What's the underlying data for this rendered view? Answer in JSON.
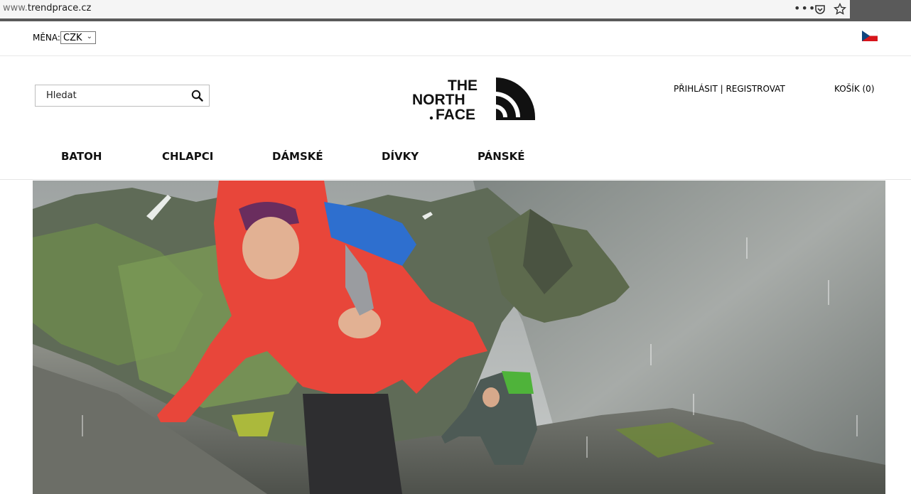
{
  "browser": {
    "url_prefix": "www.",
    "url_domain": "trendprace.cz",
    "icons": [
      "more-dots-icon",
      "pocket-icon",
      "bookmark-star-icon"
    ]
  },
  "topbar": {
    "currency_label": "MĚNA:",
    "currency_value": "CZK",
    "flag": "czech-flag-icon"
  },
  "header": {
    "search_placeholder": "Hledat",
    "logo_lines": [
      "THE",
      "NORTH",
      "FACE"
    ],
    "account": "PŘIHLÁSIT | REGISTROVAT",
    "cart": "KOŠÍK (0)"
  },
  "nav": {
    "items": [
      "BATOH",
      "CHLAPCI",
      "DÁMSKÉ",
      "DÍVKY",
      "PÁNSKÉ"
    ]
  },
  "colors": {
    "jacket_red": "#e8463a",
    "backpack_blue": "#2e6fcf",
    "backpack_green": "#4fb33a",
    "sea_gray": "#8a8f8c"
  }
}
